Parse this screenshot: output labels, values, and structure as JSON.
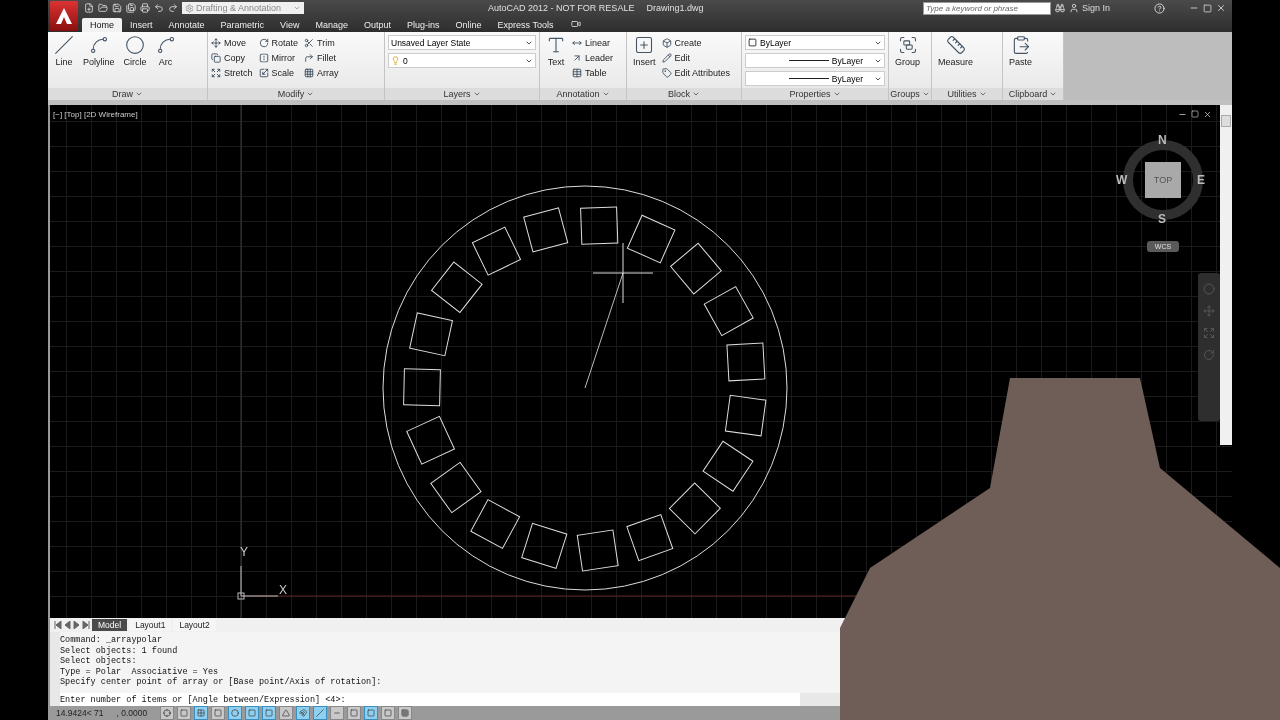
{
  "title_bar": {
    "workspace": "Drafting & Annotation",
    "title": "AutoCAD 2012 - NOT FOR RESALE",
    "file": "Drawing1.dwg",
    "search": {
      "placeholder": "Type a keyword or phrase"
    },
    "sign_in": "Sign In"
  },
  "ribbon_tabs": [
    {
      "label": "Home",
      "selected": true
    },
    {
      "label": "Insert",
      "selected": false
    },
    {
      "label": "Annotate",
      "selected": false
    },
    {
      "label": "Parametric",
      "selected": false
    },
    {
      "label": "View",
      "selected": false
    },
    {
      "label": "Manage",
      "selected": false
    },
    {
      "label": "Output",
      "selected": false
    },
    {
      "label": "Plug-ins",
      "selected": false
    },
    {
      "label": "Online",
      "selected": false
    },
    {
      "label": "Express Tools",
      "selected": false
    }
  ],
  "panels": [
    {
      "title": "Draw",
      "large": [
        "Line",
        "Polyline",
        "Circle",
        "Arc"
      ]
    },
    {
      "title": "Modify",
      "small": [
        "Move",
        "Copy",
        "Stretch",
        "Rotate",
        "Mirror",
        "Scale",
        "Trim",
        "Fillet",
        "Array"
      ]
    },
    {
      "title": "Layers",
      "dropdowns": [
        "Unsaved Layer State",
        "0"
      ]
    },
    {
      "title": "Annotation",
      "large": [
        "Text"
      ],
      "small": [
        "Linear",
        "Leader",
        "Table"
      ]
    },
    {
      "title": "Block",
      "large": [
        "Insert"
      ],
      "small": [
        "Create",
        "Edit",
        "Edit Attributes"
      ]
    },
    {
      "title": "Properties",
      "dropdowns": [
        "ByLayer",
        "ByLayer",
        "ByLayer"
      ]
    },
    {
      "title": "Groups",
      "large": [
        "Group"
      ]
    },
    {
      "title": "Utilities",
      "large": [
        "Measure"
      ]
    },
    {
      "title": "Clipboard",
      "large": [
        "Paste"
      ]
    }
  ],
  "viewport": {
    "label": "[−] [Top] [2D Wireframe]",
    "viewcube": {
      "north": "N",
      "south": "S",
      "east": "E",
      "west": "W",
      "face": "TOP",
      "ucs": "WCS"
    },
    "ucs_icon": {
      "x": "X",
      "y": "Y"
    }
  },
  "layout_tabs": [
    {
      "label": "Model",
      "selected": true
    },
    {
      "label": "Layout1",
      "selected": false
    },
    {
      "label": "Layout2",
      "selected": false
    }
  ],
  "command_history": [
    "Command: _arraypolar",
    "Select objects: 1 found",
    "Select objects:",
    "Type = Polar  Associative = Yes",
    "Specify center point of array or [Base point/Axis of rotation]:"
  ],
  "command_prompt": "Enter number of items or [Angle between/Expression] <4>:",
  "status_bar": {
    "coordinates": "14.9424< 71",
    "z": ", 0.0000",
    "toggles": [
      {
        "on": false
      },
      {
        "on": false
      },
      {
        "on": true
      },
      {
        "on": false
      },
      {
        "on": true
      },
      {
        "on": true
      },
      {
        "on": true
      },
      {
        "on": false
      },
      {
        "on": true
      },
      {
        "on": true
      },
      {
        "on": false
      },
      {
        "on": false
      },
      {
        "on": true
      },
      {
        "on": false
      },
      {
        "on": false
      }
    ]
  }
}
